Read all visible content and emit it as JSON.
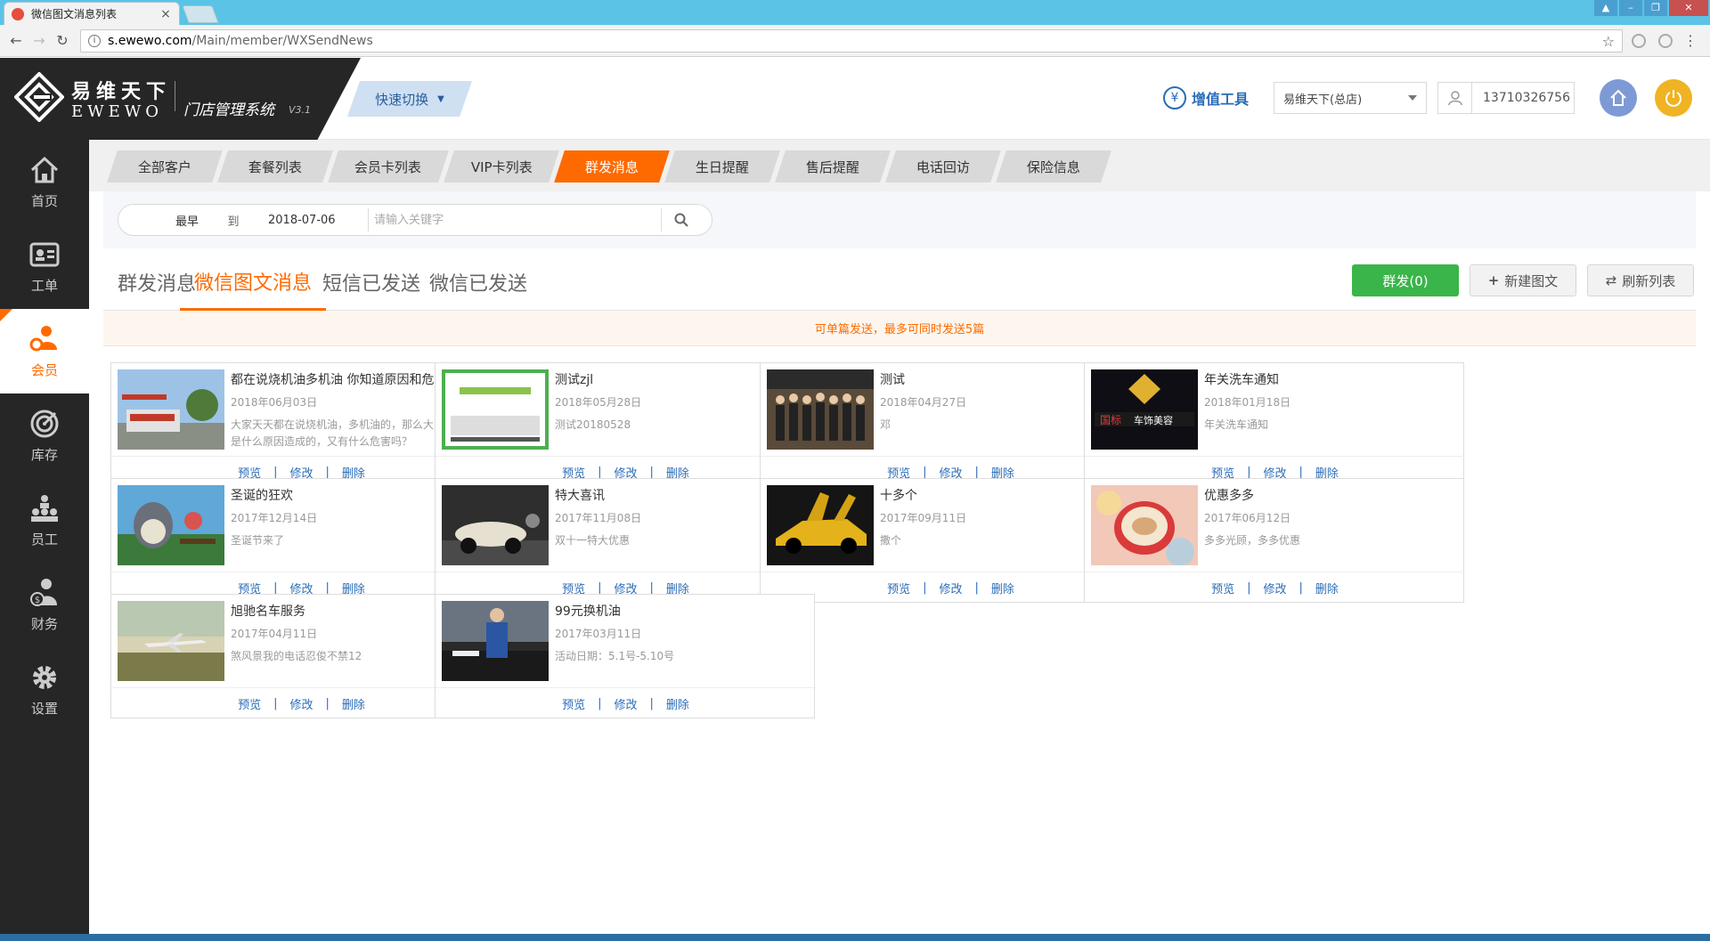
{
  "browser": {
    "tab_title": "微信图文消息列表",
    "url_host": "s.ewewo.com",
    "url_path": "/Main/member/WXSendNews"
  },
  "header": {
    "logo_cn": "易维天下",
    "logo_en": "EWEWO",
    "system_name": "门店管理系统",
    "version": "V3.1",
    "quick_switch": "快速切换",
    "value_tool": "增值工具",
    "store": "易维天下(总店)",
    "phone": "13710326756"
  },
  "sidebar": {
    "items": [
      {
        "label": "首页",
        "icon": "home-icon"
      },
      {
        "label": "工单",
        "icon": "id-card-icon"
      },
      {
        "label": "会员",
        "icon": "member-icon"
      },
      {
        "label": "库存",
        "icon": "target-icon"
      },
      {
        "label": "员工",
        "icon": "org-chart-icon"
      },
      {
        "label": "财务",
        "icon": "finance-icon"
      },
      {
        "label": "设置",
        "icon": "gear-icon"
      }
    ],
    "active_index": 2
  },
  "top_tabs": [
    "全部客户",
    "套餐列表",
    "会员卡列表",
    "VIP卡列表",
    "群发消息",
    "生日提醒",
    "售后提醒",
    "电话回访",
    "保险信息"
  ],
  "top_tab_active": 4,
  "filter": {
    "from": "最早",
    "to": "到",
    "date": "2018-07-06",
    "search_placeholder": "请输入关键字"
  },
  "sub_tabs": [
    "群发消息",
    "微信图文消息",
    "短信已发送",
    "微信已发送"
  ],
  "sub_tab_active": 1,
  "buttons": {
    "send": "群发(0)",
    "new_article": "新建图文",
    "refresh": "刷新列表"
  },
  "notice": "可单篇发送，最多可同时发送5篇",
  "action_labels": {
    "preview": "预览",
    "edit": "修改",
    "delete": "删除",
    "sep": "|"
  },
  "cards": [
    {
      "title": "都在说烧机油多机油 你知道原因和危害吗？",
      "date": "2018年06月03日",
      "desc": "大家天天都在说烧机油，多机油的，那么大家都知道是什么原因造成的，又有什么危害吗？",
      "thumb": "gas-station"
    },
    {
      "title": "测试zjl",
      "date": "2018年05月28日",
      "desc": "测试20180528",
      "thumb": "green-poster"
    },
    {
      "title": "测试",
      "date": "2018年04月27日",
      "desc": "邓",
      "thumb": "group-photo"
    },
    {
      "title": "年关洗车通知",
      "date": "2018年01月18日",
      "desc": "年关洗车通知",
      "thumb": "storefront-night"
    },
    {
      "title": "圣诞的狂欢",
      "date": "2017年12月14日",
      "desc": "圣诞节来了",
      "thumb": "totoro"
    },
    {
      "title": "特大喜讯",
      "date": "2017年11月08日",
      "desc": "双十一特大优惠",
      "thumb": "vintage-car"
    },
    {
      "title": "十多个",
      "date": "2017年09月11日",
      "desc": "撒个",
      "thumb": "yellow-sportscar"
    },
    {
      "title": "优惠多多",
      "date": "2017年06月12日",
      "desc": "多多光顾，多多优惠",
      "thumb": "coffee-cup"
    },
    {
      "title": "旭驰名车服务",
      "date": "2017年04月11日",
      "desc": "煞风景我的电话忍俊不禁12",
      "thumb": "airplane"
    },
    {
      "title": "99元换机油",
      "date": "2017年03月11日",
      "desc": "活动日期：5.1号-5.10号",
      "thumb": "car-worker"
    }
  ],
  "colors": {
    "accent": "#ff6a00",
    "link": "#2a6cb8",
    "green": "#39b54a",
    "sidebar": "#262626"
  }
}
